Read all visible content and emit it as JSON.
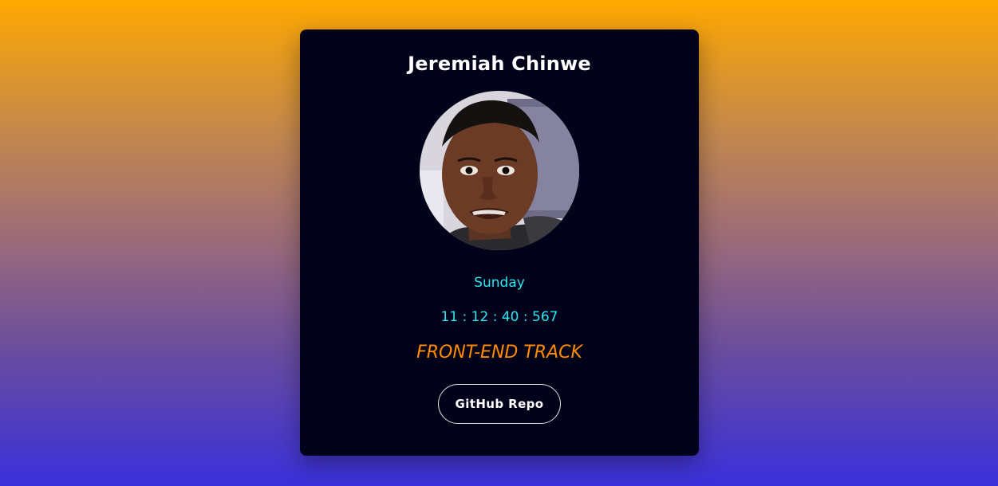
{
  "profile": {
    "name": "Jeremiah Chinwe",
    "avatar": "profile-photo"
  },
  "info": {
    "day": "Sunday",
    "time": "11 : 12 : 40 : 567",
    "track": "FRONT-END TRACK"
  },
  "actions": {
    "github_label": "GitHub Repo"
  },
  "colors": {
    "card_bg": "#02031a",
    "cyan": "#2ee6f0",
    "orange": "#ff8c00",
    "gradient_top": "#ffa800",
    "gradient_bottom": "#3a30db"
  }
}
